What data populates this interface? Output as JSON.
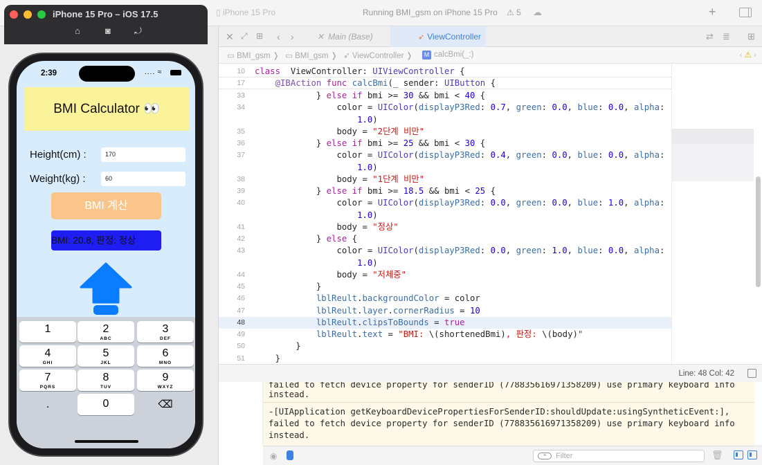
{
  "simulator": {
    "title": "iPhone 15 Pro – iOS 17.5",
    "buttons": [
      "home-icon",
      "screenshot-icon",
      "rotate-icon"
    ]
  },
  "phone": {
    "status_time": "2:39",
    "status_icons": ".... ≈",
    "app": {
      "title": "BMI Calculator 👀",
      "height_label": "Height(cm) :",
      "height_value": "170",
      "weight_label": "Weight(kg) :",
      "weight_value": "60",
      "calc_button": "BMI 계산",
      "result_text": "BMI: 20.8, 판정: 정상",
      "result_color": "#1e1ef2",
      "arrow_color": "#0a7cff"
    },
    "keypad": [
      {
        "num": "1",
        "sub": ""
      },
      {
        "num": "2",
        "sub": "ABC"
      },
      {
        "num": "3",
        "sub": "DEF"
      },
      {
        "num": "4",
        "sub": "GHI"
      },
      {
        "num": "5",
        "sub": "JKL"
      },
      {
        "num": "6",
        "sub": "MNO"
      },
      {
        "num": "7",
        "sub": "PQRS"
      },
      {
        "num": "8",
        "sub": "TUV"
      },
      {
        "num": "9",
        "sub": "WXYZ"
      }
    ],
    "key_dot": ".",
    "key_zero": "0",
    "key_delete": "⌫"
  },
  "xcode": {
    "toolbar": {
      "scheme": "iPhone 15 Pro",
      "status": "Running BMI_gsm on iPhone 15 Pro",
      "warnings": "5"
    },
    "tabs": [
      {
        "label": "Main (Base)"
      },
      {
        "label": "ViewController"
      }
    ],
    "breadcrumbs": [
      "BMI_gsm",
      "BMI_gsm",
      "ViewController",
      "calcBmi(_:)"
    ],
    "code_lines": [
      {
        "ln": "10",
        "kind": "sticky",
        "tokens": [
          [
            "kw",
            "class"
          ],
          [
            "",
            "  ViewController: "
          ],
          [
            "ty",
            "UIViewController"
          ],
          [
            "",
            " {"
          ]
        ]
      },
      {
        "ln": "17",
        "kind": "sticky",
        "tokens": [
          [
            "",
            "    "
          ],
          [
            "at",
            "@IBAction"
          ],
          [
            "",
            " "
          ],
          [
            "kw",
            "func"
          ],
          [
            "",
            " "
          ],
          [
            "pr",
            "calcBmi"
          ],
          [
            "",
            "(_ sender: "
          ],
          [
            "ty",
            "UIButton"
          ],
          [
            "",
            " {"
          ]
        ]
      },
      {
        "ln": "33",
        "kind": "",
        "tokens": [
          [
            "",
            "            } "
          ],
          [
            "kw",
            "else if"
          ],
          [
            "",
            " bmi >= "
          ],
          [
            "nu",
            "30"
          ],
          [
            "",
            " && bmi < "
          ],
          [
            "nu",
            "40"
          ],
          [
            "",
            " {"
          ]
        ]
      },
      {
        "ln": "34",
        "kind": "",
        "tokens": [
          [
            "",
            "                color = "
          ],
          [
            "ty",
            "UIColor"
          ],
          [
            "",
            "("
          ],
          [
            "pr",
            "displayP3Red"
          ],
          [
            "",
            ": "
          ],
          [
            "nu",
            "0.7"
          ],
          [
            "",
            ", "
          ],
          [
            "pr",
            "green"
          ],
          [
            "",
            ": "
          ],
          [
            "nu",
            "0.0"
          ],
          [
            "",
            ", "
          ],
          [
            "pr",
            "blue"
          ],
          [
            "",
            ": "
          ],
          [
            "nu",
            "0.0"
          ],
          [
            "",
            ", "
          ],
          [
            "pr",
            "alpha"
          ],
          [
            "",
            ":"
          ]
        ]
      },
      {
        "ln": "",
        "kind": "",
        "tokens": [
          [
            "",
            "                    "
          ],
          [
            "nu",
            "1.0"
          ],
          [
            "",
            ")"
          ]
        ]
      },
      {
        "ln": "35",
        "kind": "",
        "tokens": [
          [
            "",
            "                body = "
          ],
          [
            "st",
            "\"2단계 비만\""
          ]
        ]
      },
      {
        "ln": "36",
        "kind": "",
        "tokens": [
          [
            "",
            "            } "
          ],
          [
            "kw",
            "else if"
          ],
          [
            "",
            " bmi >= "
          ],
          [
            "nu",
            "25"
          ],
          [
            "",
            " && bmi < "
          ],
          [
            "nu",
            "30"
          ],
          [
            "",
            " {"
          ]
        ]
      },
      {
        "ln": "37",
        "kind": "",
        "tokens": [
          [
            "",
            "                color = "
          ],
          [
            "ty",
            "UIColor"
          ],
          [
            "",
            "("
          ],
          [
            "pr",
            "displayP3Red"
          ],
          [
            "",
            ": "
          ],
          [
            "nu",
            "0.4"
          ],
          [
            "",
            ", "
          ],
          [
            "pr",
            "green"
          ],
          [
            "",
            ": "
          ],
          [
            "nu",
            "0.0"
          ],
          [
            "",
            ", "
          ],
          [
            "pr",
            "blue"
          ],
          [
            "",
            ": "
          ],
          [
            "nu",
            "0.0"
          ],
          [
            "",
            ", "
          ],
          [
            "pr",
            "alpha"
          ],
          [
            "",
            ":"
          ]
        ]
      },
      {
        "ln": "",
        "kind": "",
        "tokens": [
          [
            "",
            "                    "
          ],
          [
            "nu",
            "1.0"
          ],
          [
            "",
            ")"
          ]
        ]
      },
      {
        "ln": "38",
        "kind": "",
        "tokens": [
          [
            "",
            "                body = "
          ],
          [
            "st",
            "\"1단계 비만\""
          ]
        ]
      },
      {
        "ln": "39",
        "kind": "",
        "tokens": [
          [
            "",
            "            } "
          ],
          [
            "kw",
            "else if"
          ],
          [
            "",
            " bmi >= "
          ],
          [
            "nu",
            "18.5"
          ],
          [
            "",
            " && bmi < "
          ],
          [
            "nu",
            "25"
          ],
          [
            "",
            " {"
          ]
        ]
      },
      {
        "ln": "40",
        "kind": "",
        "tokens": [
          [
            "",
            "                color = "
          ],
          [
            "ty",
            "UIColor"
          ],
          [
            "",
            "("
          ],
          [
            "pr",
            "displayP3Red"
          ],
          [
            "",
            ": "
          ],
          [
            "nu",
            "0.0"
          ],
          [
            "",
            ", "
          ],
          [
            "pr",
            "green"
          ],
          [
            "",
            ": "
          ],
          [
            "nu",
            "0.0"
          ],
          [
            "",
            ", "
          ],
          [
            "pr",
            "blue"
          ],
          [
            "",
            ": "
          ],
          [
            "nu",
            "1.0"
          ],
          [
            "",
            ", "
          ],
          [
            "pr",
            "alpha"
          ],
          [
            "",
            ":"
          ]
        ]
      },
      {
        "ln": "",
        "kind": "",
        "tokens": [
          [
            "",
            "                    "
          ],
          [
            "nu",
            "1.0"
          ],
          [
            "",
            ")"
          ]
        ]
      },
      {
        "ln": "41",
        "kind": "",
        "tokens": [
          [
            "",
            "                body = "
          ],
          [
            "st",
            "\"정상\""
          ]
        ]
      },
      {
        "ln": "42",
        "kind": "",
        "tokens": [
          [
            "",
            "            } "
          ],
          [
            "kw",
            "else"
          ],
          [
            "",
            " {"
          ]
        ]
      },
      {
        "ln": "43",
        "kind": "",
        "tokens": [
          [
            "",
            "                color = "
          ],
          [
            "ty",
            "UIColor"
          ],
          [
            "",
            "("
          ],
          [
            "pr",
            "displayP3Red"
          ],
          [
            "",
            ": "
          ],
          [
            "nu",
            "0.0"
          ],
          [
            "",
            ", "
          ],
          [
            "pr",
            "green"
          ],
          [
            "",
            ": "
          ],
          [
            "nu",
            "1.0"
          ],
          [
            "",
            ", "
          ],
          [
            "pr",
            "blue"
          ],
          [
            "",
            ": "
          ],
          [
            "nu",
            "0.0"
          ],
          [
            "",
            ", "
          ],
          [
            "pr",
            "alpha"
          ],
          [
            "",
            ":"
          ]
        ]
      },
      {
        "ln": "",
        "kind": "",
        "tokens": [
          [
            "",
            "                    "
          ],
          [
            "nu",
            "1.0"
          ],
          [
            "",
            ")"
          ]
        ]
      },
      {
        "ln": "44",
        "kind": "",
        "tokens": [
          [
            "",
            "                body = "
          ],
          [
            "st",
            "\"저체중\""
          ]
        ]
      },
      {
        "ln": "45",
        "kind": "",
        "tokens": [
          [
            "",
            "            }"
          ]
        ]
      },
      {
        "ln": "46",
        "kind": "",
        "tokens": [
          [
            "",
            "            "
          ],
          [
            "pr",
            "lblReult"
          ],
          [
            "",
            "."
          ],
          [
            "pr",
            "backgroundColor"
          ],
          [
            "",
            " = color"
          ]
        ]
      },
      {
        "ln": "47",
        "kind": "",
        "tokens": [
          [
            "",
            "            "
          ],
          [
            "pr",
            "lblReult"
          ],
          [
            "",
            "."
          ],
          [
            "pr",
            "layer"
          ],
          [
            "",
            "."
          ],
          [
            "pr",
            "cornerRadius"
          ],
          [
            "",
            " = "
          ],
          [
            "nu",
            "10"
          ]
        ]
      },
      {
        "ln": "48",
        "kind": "current",
        "tokens": [
          [
            "",
            "            "
          ],
          [
            "pr",
            "lblReult"
          ],
          [
            "",
            "."
          ],
          [
            "pr",
            "clipsToBounds"
          ],
          [
            "",
            " = "
          ],
          [
            "kw",
            "true"
          ]
        ]
      },
      {
        "ln": "49",
        "kind": "",
        "tokens": [
          [
            "",
            "            "
          ],
          [
            "pr",
            "lblReult"
          ],
          [
            "",
            "."
          ],
          [
            "pr",
            "text"
          ],
          [
            "",
            " = "
          ],
          [
            "st",
            "\"BMI: "
          ],
          [
            "",
            "\\(shortenedBmi)"
          ],
          [
            "st",
            ", 판정: "
          ],
          [
            "",
            "\\(body)"
          ],
          [
            "st",
            "\""
          ]
        ]
      },
      {
        "ln": "50",
        "kind": "",
        "tokens": [
          [
            "",
            "        }"
          ]
        ]
      },
      {
        "ln": "51",
        "kind": "",
        "tokens": [
          [
            "",
            "    }"
          ]
        ]
      }
    ],
    "line_col": "Line: 48  Col: 42",
    "console_lines": [
      "failed to fetch device property for senderID (778835616971358209) use primary keyboard info",
      "instead.",
      "-[UIApplication getKeyboardDevicePropertiesForSenderID:shouldUpdate:usingSyntheticEvent:],",
      "failed to fetch device property for senderID (778835616971358209) use primary keyboard info",
      "instead."
    ],
    "filter_placeholder": "Filter"
  }
}
